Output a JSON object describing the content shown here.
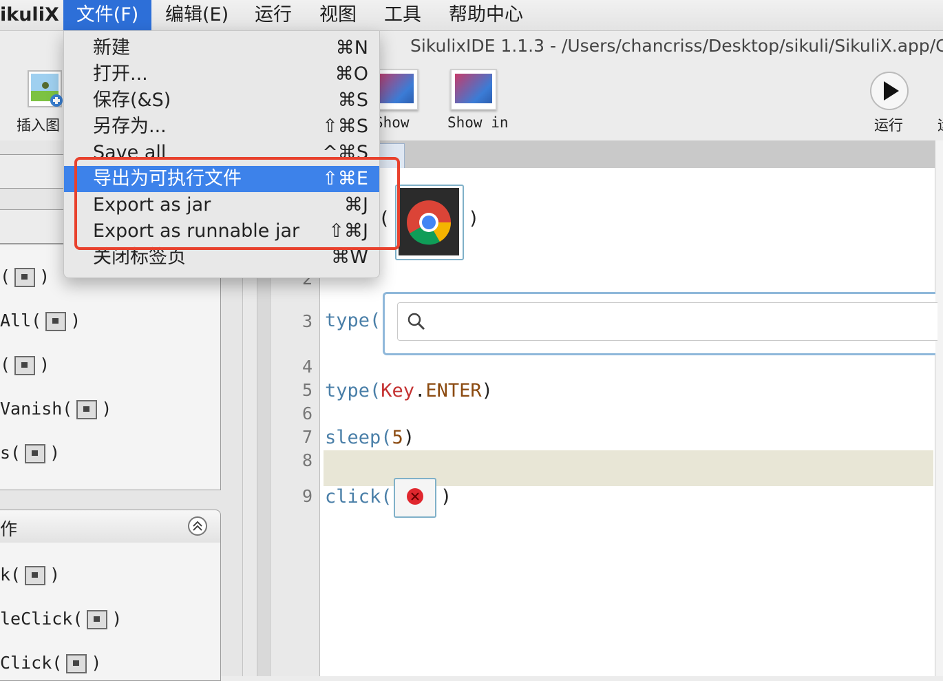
{
  "menubar": {
    "app_name": "ikuliX",
    "items": [
      "文件(F)",
      "编辑(E)",
      "运行",
      "视图",
      "工具",
      "帮助中心"
    ]
  },
  "window": {
    "title": "SikulixIDE 1.1.3 - /Users/chancriss/Desktop/sikuli/SikuliX.app/Co"
  },
  "toolbar": {
    "insert_image_label": "插入图",
    "show_label": "Show",
    "show_in_label": "Show in",
    "run_label": "运行",
    "extra_label": "运"
  },
  "file_menu": [
    {
      "label": "新建",
      "shortcut": "⌘N"
    },
    {
      "label": "打开...",
      "shortcut": "⌘O"
    },
    {
      "label": "保存(&S)",
      "shortcut": "⌘S"
    },
    {
      "label": "另存为...",
      "shortcut": "⇧⌘S"
    },
    {
      "label": "Save all",
      "shortcut": "^⌘S"
    },
    {
      "label": "导出为可执行文件",
      "shortcut": "⇧⌘E"
    },
    {
      "label": "Export as jar",
      "shortcut": "⌘J"
    },
    {
      "label": "Export as runnable jar",
      "shortcut": "⇧⌘J"
    },
    {
      "label": "关闭标签页",
      "shortcut": "⌘W"
    }
  ],
  "left_panel": {
    "find_commands": [
      "(",
      "All(",
      "(",
      "Vanish(",
      "s("
    ],
    "section2_title": "作",
    "action_commands": [
      "k(",
      "leClick(",
      "Click("
    ]
  },
  "editor": {
    "line_numbers": [
      "2",
      "3",
      "4",
      "5",
      "6",
      "7",
      "8",
      "9"
    ],
    "line3": "type(",
    "line5": {
      "fn": "type(",
      "key": "Key",
      "dot": ".",
      "const": "ENTER",
      "close": ")"
    },
    "line7": {
      "fn": "sleep(",
      "num": "5",
      "close": ")"
    },
    "line9": {
      "fn": "click(",
      "close": ")"
    },
    "line1_open": "(",
    "line1_close": ")"
  }
}
